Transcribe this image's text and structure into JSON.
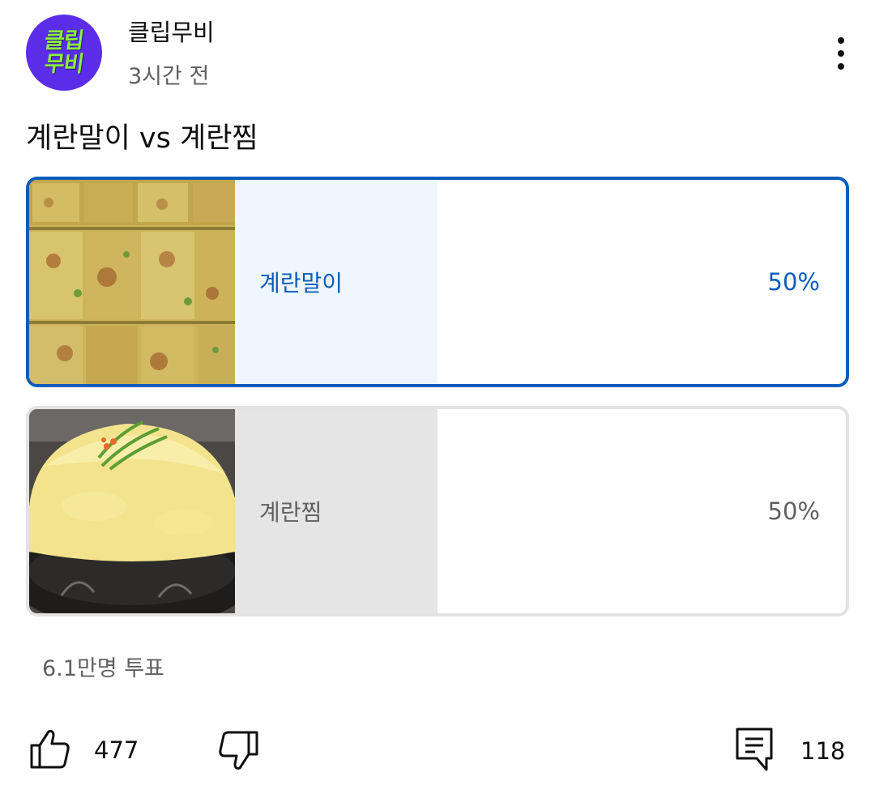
{
  "channel": {
    "avatar_text_line1": "클립",
    "avatar_text_line2": "무비",
    "name": "클립무비",
    "posted": "3시간 전"
  },
  "post": {
    "title": "계란말이 vs 계란찜"
  },
  "poll": {
    "options": [
      {
        "label": "계란말이",
        "percent": "50%",
        "share": 0.5,
        "selected": true
      },
      {
        "label": "계란찜",
        "percent": "50%",
        "share": 0.5,
        "selected": false
      }
    ],
    "total_votes": "6.1만명 투표"
  },
  "actions": {
    "likes": "477",
    "comments": "118"
  },
  "colors": {
    "accent": "#0b5cbc",
    "selected_fill": "#eef6fe",
    "unselected_fill": "#e5e5e5",
    "avatar_bg": "#5b2de8",
    "avatar_text": "#8cf23a"
  }
}
